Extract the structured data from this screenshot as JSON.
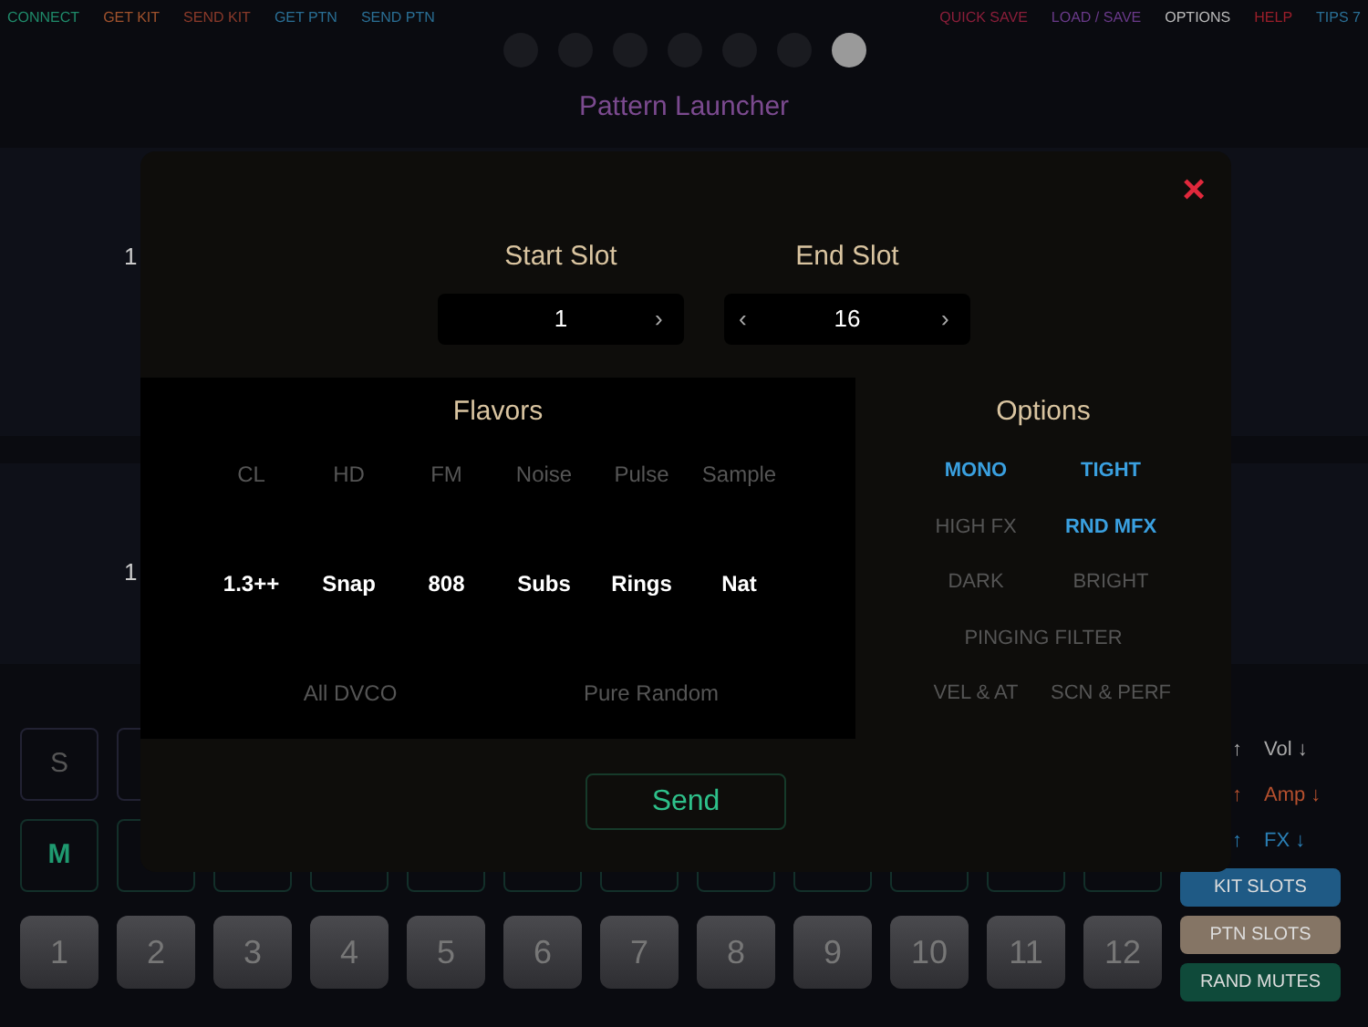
{
  "top_bar": {
    "left": [
      {
        "label": "CONNECT",
        "color": "#1f8a6a"
      },
      {
        "label": "GET KIT",
        "color": "#a0522d"
      },
      {
        "label": "SEND KIT",
        "color": "#8b3a2a"
      },
      {
        "label": "GET PTN",
        "color": "#2a6f95"
      },
      {
        "label": "SEND PTN",
        "color": "#2a6f95"
      }
    ],
    "right": [
      {
        "label": "QUICK SAVE",
        "color": "#8b1e3a"
      },
      {
        "label": "LOAD / SAVE",
        "color": "#6a3a8a"
      },
      {
        "label": "OPTIONS",
        "color": "#bbbbbb"
      },
      {
        "label": "HELP",
        "color": "#9a1e2a"
      },
      {
        "label": "TIPS 7",
        "color": "#2a6f95"
      }
    ]
  },
  "page_dots": [
    {
      "selected": false
    },
    {
      "selected": false
    },
    {
      "selected": false
    },
    {
      "selected": false
    },
    {
      "selected": false
    },
    {
      "selected": false
    },
    {
      "selected": true
    }
  ],
  "title": "Pattern Launcher",
  "background_panels": [
    {
      "number": "1"
    },
    {
      "number": "1"
    }
  ],
  "dialog": {
    "close": "×",
    "start_slot": {
      "label": "Start Slot",
      "value": "1",
      "next": "›"
    },
    "end_slot": {
      "label": "End Slot",
      "value": "16",
      "prev": "‹",
      "next": "›"
    },
    "flavors": {
      "title": "Flavors",
      "rows": [
        [
          {
            "label": "CL",
            "selected": false
          },
          {
            "label": "HD",
            "selected": false
          },
          {
            "label": "FM",
            "selected": false
          },
          {
            "label": "Noise",
            "selected": false
          },
          {
            "label": "Pulse",
            "selected": false
          },
          {
            "label": "Sample",
            "selected": false
          }
        ],
        [
          {
            "label": "1.3++",
            "selected": true
          },
          {
            "label": "Snap",
            "selected": true
          },
          {
            "label": "808",
            "selected": true
          },
          {
            "label": "Subs",
            "selected": true
          },
          {
            "label": "Rings",
            "selected": true
          },
          {
            "label": "Nat",
            "selected": true
          }
        ]
      ],
      "extras": [
        {
          "label": "All DVCO",
          "selected": false
        },
        {
          "label": "Pure Random",
          "selected": false
        }
      ]
    },
    "options": {
      "title": "Options",
      "rows": [
        [
          {
            "label": "MONO",
            "selected": true
          },
          {
            "label": "TIGHT",
            "selected": true
          }
        ],
        [
          {
            "label": "HIGH FX",
            "selected": false
          },
          {
            "label": "RND MFX",
            "selected": true
          }
        ],
        [
          {
            "label": "DARK",
            "selected": false
          },
          {
            "label": "BRIGHT",
            "selected": false
          }
        ],
        [
          {
            "label": "PINGING FILTER",
            "selected": false
          }
        ],
        [
          {
            "label": "VEL & AT",
            "selected": false
          },
          {
            "label": "SCN & PERF",
            "selected": false
          }
        ]
      ]
    },
    "send": "Send"
  },
  "solo_button": "S",
  "mute_button": "M",
  "pads": [
    "1",
    "2",
    "3",
    "4",
    "5",
    "6",
    "7",
    "8",
    "9",
    "10",
    "11",
    "12"
  ],
  "levels": [
    {
      "left": "↑",
      "right": "Vol ↓",
      "color": "#aaaaaa"
    },
    {
      "left": "↑",
      "right": "Amp ↓",
      "color": "#b5502e"
    },
    {
      "left": "↑",
      "right": "FX ↓",
      "color": "#2a7fb5"
    }
  ],
  "slot_buttons": [
    {
      "label": "KIT SLOTS",
      "color": "#1f5a85"
    },
    {
      "label": "PTN SLOTS",
      "color": "#857565"
    },
    {
      "label": "RAND MUTES",
      "color": "#0f4a3a"
    }
  ]
}
